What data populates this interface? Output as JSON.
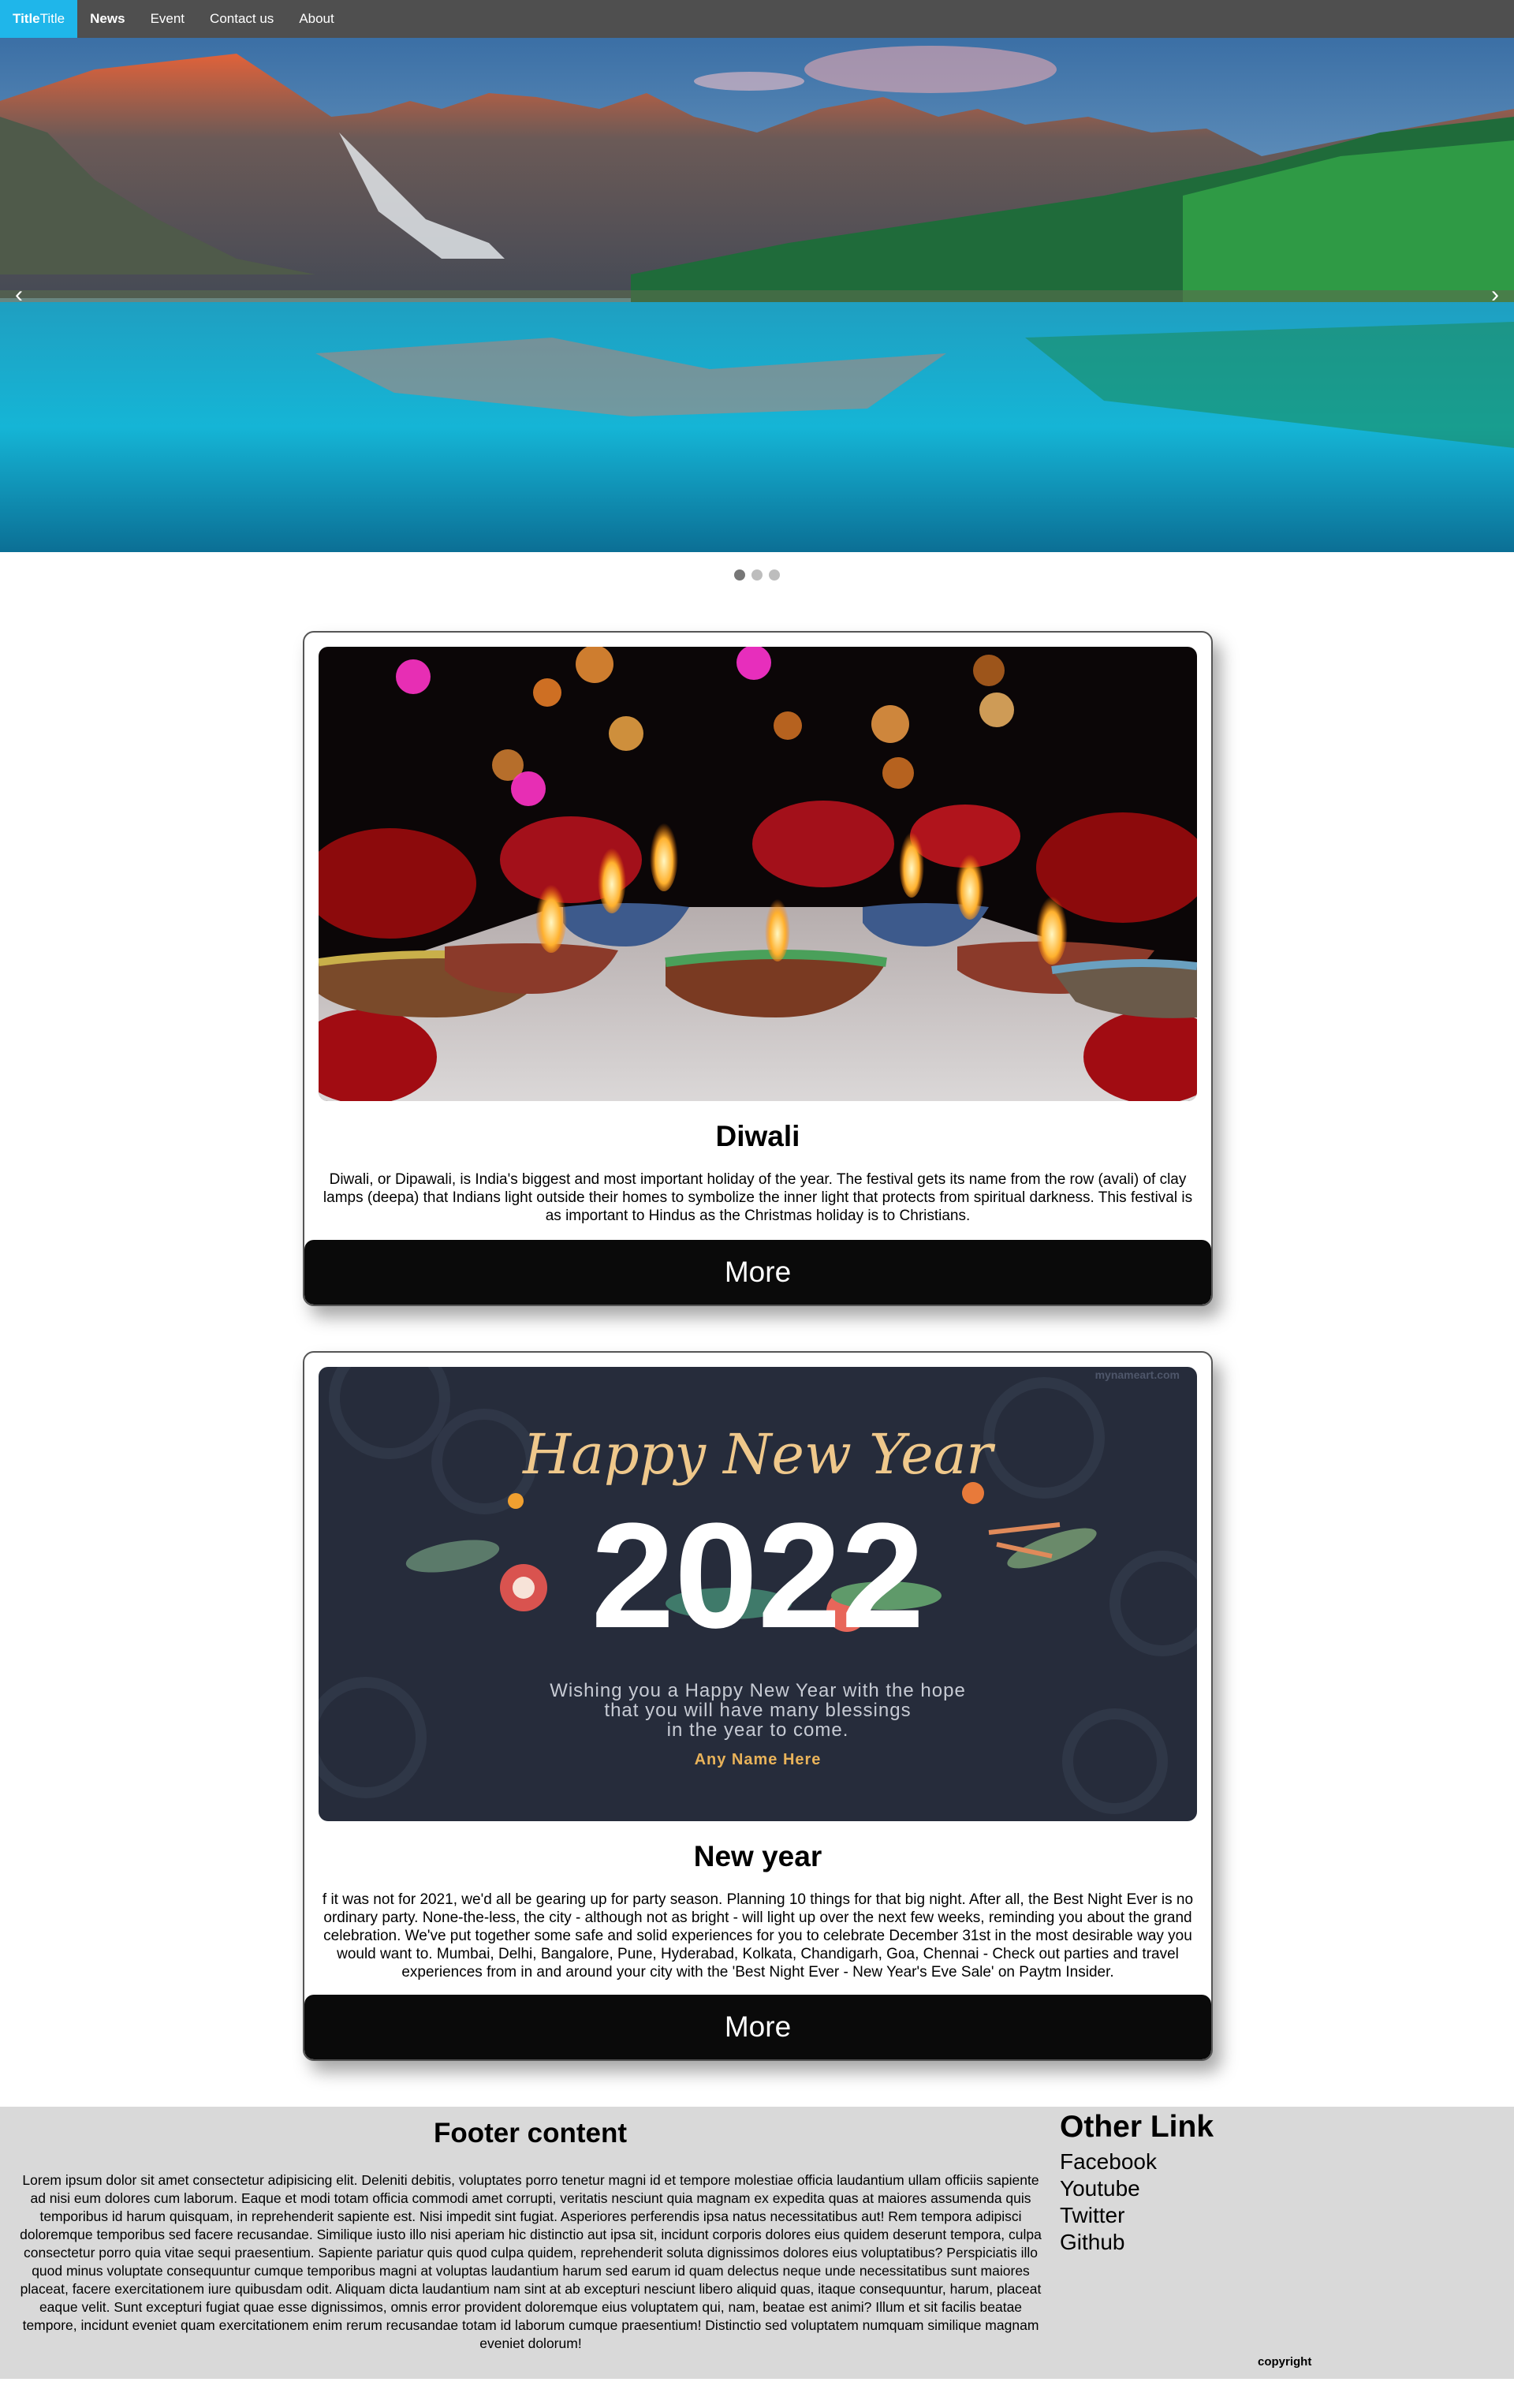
{
  "nav": {
    "brand_part1": "Title",
    "brand_part2": "Title",
    "links": [
      "News",
      "Event",
      "Contact us",
      "About"
    ]
  },
  "carousel": {
    "prev_icon": "‹",
    "next_icon": "›",
    "active_index": 0,
    "slide_count": 3
  },
  "cards": [
    {
      "title": "Diwali",
      "text": "Diwali, or Dipawali, is India's biggest and most important holiday of the year. The festival gets its name from the row (avali) of clay lamps (deepa) that Indians light outside their homes to symbolize the inner light that protects from spiritual darkness. This festival is as important to Hindus as the Christmas holiday is to Christians.",
      "button": "More"
    },
    {
      "title": "New year",
      "text": "f it was not for 2021, we'd all be gearing up for party season. Planning 10 things for that big night. After all, the Best Night Ever is no ordinary party. None-the-less, the city - although not as bright - will light up over the next few weeks, reminding you about the grand celebration. We've put together some safe and solid experiences for you to celebrate December 31st in the most desirable way you would want to. Mumbai, Delhi, Bangalore, Pune, Hyderabad, Kolkata, Chandigarh, Goa, Chennai - Check out parties and travel experiences from in and around your city with the 'Best Night Ever - New Year's Eve Sale' on Paytm Insider.",
      "button": "More",
      "image_text": {
        "watermark": "mynameart.com",
        "headline": "Happy New Year",
        "year": "2022",
        "wish_line1": "Wishing you a Happy New Year with the hope",
        "wish_line2": "that you will have many blessings",
        "wish_line3": "in the year to come.",
        "name": "Any Name Here"
      }
    }
  ],
  "footer": {
    "title": "Footer content",
    "text": "Lorem ipsum dolor sit amet consectetur adipisicing elit. Deleniti debitis, voluptates porro tenetur magni id et tempore molestiae officia laudantium ullam officiis sapiente ad nisi eum dolores cum laborum. Eaque et modi totam officia commodi amet corrupti, veritatis nesciunt quia magnam ex expedita quas at maiores assumenda quis temporibus id harum quisquam, in reprehenderit sapiente est. Nisi impedit sint fugiat. Asperiores perferendis ipsa natus necessitatibus aut! Rem tempora adipisci doloremque temporibus sed facere recusandae. Similique iusto illo nisi aperiam hic distinctio aut ipsa sit, incidunt corporis dolores eius quidem deserunt tempora, culpa consectetur porro quia vitae sequi praesentium. Sapiente pariatur quis quod culpa quidem, reprehenderit soluta dignissimos dolores eius voluptatibus? Perspiciatis illo quod minus voluptate consequuntur cumque temporibus magni at voluptas laudantium harum sed earum id quam delectus neque unde necessitatibus sunt maiores placeat, facere exercitationem iure quibusdam odit. Aliquam dicta laudantium nam sint at ab excepturi nesciunt libero aliquid quas, itaque consequuntur, harum, placeat eaque velit. Sunt excepturi fugiat quae esse dignissimos, omnis error provident doloremque eius voluptatem qui, nam, beatae est animi? Illum et sit facilis beatae tempore, incidunt eveniet quam exercitationem enim rerum recusandae totam id laborum cumque praesentium! Distinctio sed voluptatem numquam similique magnam eveniet dolorum!",
    "links_title": "Other Link",
    "links": [
      "Facebook",
      "Youtube",
      "Twitter",
      "Github"
    ],
    "copyright": "copyright"
  }
}
